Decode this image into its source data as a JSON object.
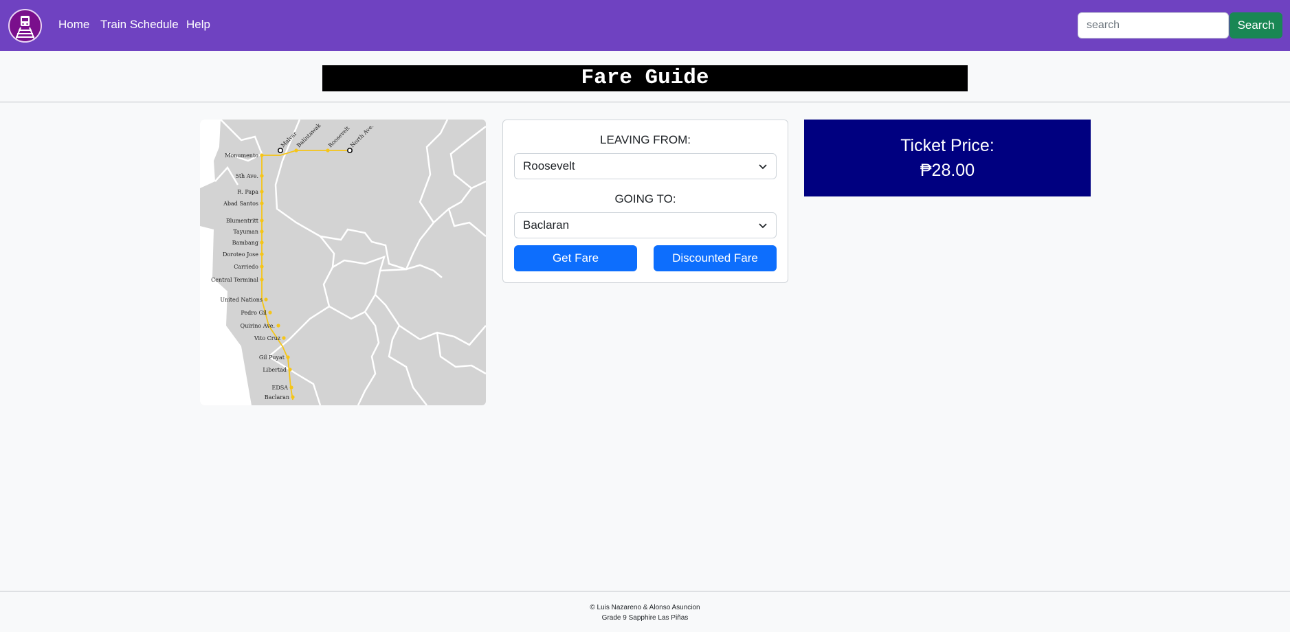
{
  "nav": {
    "links": [
      "Home",
      "Train Schedule",
      "Help"
    ],
    "search_placeholder": "search",
    "search_button": "Search",
    "brand_color": "#6f42c1"
  },
  "page": {
    "title": "Fare Guide"
  },
  "map": {
    "line_color": "#f5c518",
    "stations": [
      "Monumento",
      "5th Ave.",
      "R. Papa",
      "Abad Santos",
      "Blumentritt",
      "Tayuman",
      "Bambang",
      "Doroteo Jose",
      "Carriedo",
      "Central Terminal",
      "United Nations",
      "Pedro Gil",
      "Quirino Ave.",
      "Vito Cruz",
      "Gil Puyat",
      "Libertad",
      "EDSA",
      "Baclaran"
    ],
    "top_stations": [
      "Malvar",
      "Balintawak",
      "Roosevelt",
      "North Ave."
    ]
  },
  "form": {
    "leaving_label": "LEAVING FROM:",
    "leaving_value": "Roosevelt",
    "going_label": "GOING TO:",
    "going_value": "Baclaran",
    "get_fare": "Get Fare",
    "discounted_fare": "Discounted Fare"
  },
  "result": {
    "label": "Ticket Price:",
    "value": "₱28.00",
    "bg_color": "#000080"
  },
  "footer": {
    "line1": "© Luis Nazareno & Alonso Asuncion",
    "line2": "Grade 9 Sapphire Las Piñas"
  }
}
